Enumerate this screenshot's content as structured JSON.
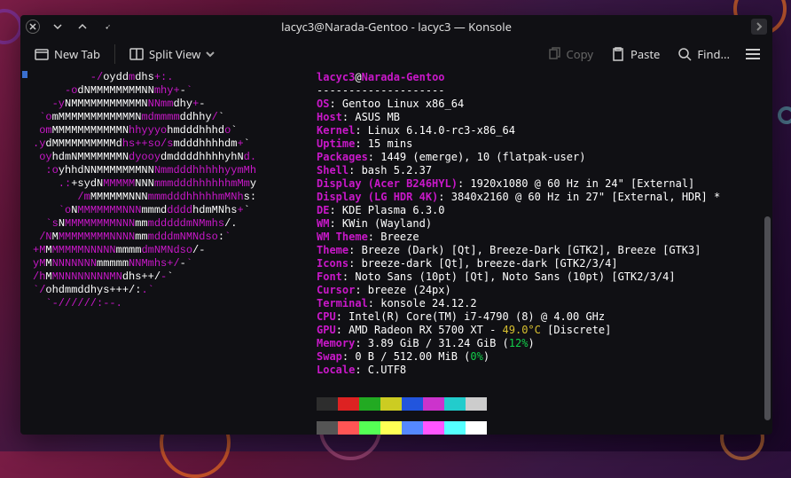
{
  "window": {
    "title": "lacyc3@Narada-Gentoo - lacyc3 — Konsole"
  },
  "toolbar": {
    "new_tab": "New Tab",
    "split_view": "Split View",
    "copy": "Copy",
    "paste": "Paste",
    "find": "Find..."
  },
  "fetch": {
    "user": "lacyc3",
    "at": "@",
    "host": "Narada-Gentoo",
    "sep": "--------------------",
    "rows": [
      {
        "k": "OS",
        "v": ": Gentoo Linux x86_64"
      },
      {
        "k": "Host",
        "v": ": ASUS MB"
      },
      {
        "k": "Kernel",
        "v": ": Linux 6.14.0-rc3-x86_64"
      },
      {
        "k": "Uptime",
        "v": ": 15 mins"
      },
      {
        "k": "Packages",
        "v": ": 1449 (emerge), 10 (flatpak-user)"
      },
      {
        "k": "Shell",
        "v": ": bash 5.2.37"
      },
      {
        "k": "Display (Acer B246HYL)",
        "v": ": 1920x1080 @ 60 Hz in 24\" [External]"
      },
      {
        "k": "Display (LG HDR 4K)",
        "v": ": 3840x2160 @ 60 Hz in 27\" [External, HDR] *"
      },
      {
        "k": "DE",
        "v": ": KDE Plasma 6.3.0"
      },
      {
        "k": "WM",
        "v": ": KWin (Wayland)"
      },
      {
        "k": "WM Theme",
        "v": ": Breeze"
      },
      {
        "k": "Theme",
        "v": ": Breeze (Dark) [Qt], Breeze-Dark [GTK2], Breeze [GTK3]"
      },
      {
        "k": "Icons",
        "v": ": breeze-dark [Qt], breeze-dark [GTK2/3/4]"
      },
      {
        "k": "Font",
        "v": ": Noto Sans (10pt) [Qt], Noto Sans (10pt) [GTK2/3/4]"
      },
      {
        "k": "Cursor",
        "v": ": breeze (24px)"
      },
      {
        "k": "Terminal",
        "v": ": konsole 24.12.2"
      },
      {
        "k": "CPU",
        "v": ": Intel(R) Core(TM) i7-4790 (8) @ 4.00 GHz"
      },
      {
        "k": "GPU",
        "v_pre": ": AMD Radeon RX 5700 XT - ",
        "temp": "49.0°C",
        "v_post": " [Discrete]"
      },
      {
        "k": "Memory",
        "v_pre": ": 3.89 GiB / 31.24 GiB (",
        "pct": "12%",
        "v_post": ")"
      },
      {
        "k": "Swap",
        "v_pre": ": 0 B / 512.00 MiB (",
        "pct": "0%",
        "v_post": ")"
      },
      {
        "k": "Locale",
        "v": ": C.UTF8"
      }
    ],
    "palette_row1": [
      "#2d2d2d",
      "#d22",
      "#2a2",
      "#cc2",
      "#25d",
      "#c3c",
      "#2cc",
      "#ccc"
    ],
    "palette_row2": [
      "#555",
      "#f55",
      "#5f5",
      "#ff5",
      "#58f",
      "#f5f",
      "#5ff",
      "#fff"
    ]
  },
  "logo_lines": [
    [
      [
        "m",
        "         -/"
      ],
      [
        "w",
        "oydd"
      ],
      [
        "m",
        "m"
      ],
      [
        "w",
        "dhs"
      ],
      [
        "m",
        "+:."
      ]
    ],
    [
      [
        "m",
        "     -o"
      ],
      [
        "w",
        "dNMMMMMMMMNN"
      ],
      [
        "m",
        "mhy+"
      ],
      [
        "w",
        "-"
      ],
      [
        "m",
        "`"
      ]
    ],
    [
      [
        "m",
        "   -y"
      ],
      [
        "w",
        "NMMMMMMMMMMMN"
      ],
      [
        "m",
        "NNmm"
      ],
      [
        "w",
        "dhy"
      ],
      [
        "m",
        "+"
      ],
      [
        "w",
        "-"
      ]
    ],
    [
      [
        "m",
        " `o"
      ],
      [
        "w",
        "mMMMMMMMMMMMMN"
      ],
      [
        "m",
        "mdmmmm"
      ],
      [
        "w",
        "ddhhy"
      ],
      [
        "m",
        "/"
      ],
      [
        "w",
        "`"
      ]
    ],
    [
      [
        "m",
        " om"
      ],
      [
        "w",
        "MMMMMMMMMMMN"
      ],
      [
        "m",
        "hhyyyo"
      ],
      [
        "w",
        "hmdddhhhd"
      ],
      [
        "m",
        "o"
      ],
      [
        "w",
        "`"
      ]
    ],
    [
      [
        "m",
        ".y"
      ],
      [
        "w",
        "dMMMMMMMMMMd"
      ],
      [
        "m",
        "hs++so/s"
      ],
      [
        "w",
        "mdddhhhhdm"
      ],
      [
        "m",
        "+"
      ],
      [
        "w",
        "`"
      ]
    ],
    [
      [
        "m",
        " oy"
      ],
      [
        "w",
        "hdmNMMMMMMMN"
      ],
      [
        "m",
        "dyooy"
      ],
      [
        "w",
        "dmddddhhhhyhN"
      ],
      [
        "m",
        "d."
      ]
    ],
    [
      [
        "m",
        "  :o"
      ],
      [
        "w",
        "yhhdNNMMMMMMMNN"
      ],
      [
        "m",
        "NmmdddhhhhhyymMh"
      ]
    ],
    [
      [
        "m",
        "    .:"
      ],
      [
        "w",
        "+sydN"
      ],
      [
        "m",
        "MMMMM"
      ],
      [
        "w",
        "NNN"
      ],
      [
        "m",
        "mmmdddhhhhhhmMm"
      ],
      [
        "w",
        "y"
      ]
    ],
    [
      [
        "m",
        "       /m"
      ],
      [
        "w",
        "MMMMMMNNN"
      ],
      [
        "m",
        "mmmdddhhhhhmMNh"
      ],
      [
        "w",
        "s:"
      ]
    ],
    [
      [
        "m",
        "    `o"
      ],
      [
        "w",
        "N"
      ],
      [
        "m",
        "MMMMMMMNNN"
      ],
      [
        "w",
        "mmmd"
      ],
      [
        "m",
        "dddd"
      ],
      [
        "w",
        "hdmMNhs"
      ],
      [
        "m",
        "+"
      ],
      [
        "w",
        "`"
      ]
    ],
    [
      [
        "m",
        "  `s"
      ],
      [
        "w",
        "N"
      ],
      [
        "m",
        "MMMMMMMMNNN"
      ],
      [
        "w",
        "mm"
      ],
      [
        "m",
        "mdddddmNMmhs"
      ],
      [
        "w",
        "/."
      ]
    ],
    [
      [
        "m",
        " /N"
      ],
      [
        "w",
        "M"
      ],
      [
        "m",
        "MMMMMMMMNNNN"
      ],
      [
        "w",
        "mm"
      ],
      [
        "m",
        "mdddmNMNdso"
      ],
      [
        "w",
        ":"
      ],
      [
        "m",
        "`"
      ]
    ],
    [
      [
        "m",
        "+M"
      ],
      [
        "w",
        "M"
      ],
      [
        "m",
        "MMMMMNNNNN"
      ],
      [
        "w",
        "mmmm"
      ],
      [
        "m",
        "dmNMNdso"
      ],
      [
        "w",
        "/-"
      ]
    ],
    [
      [
        "m",
        "yM"
      ],
      [
        "w",
        "M"
      ],
      [
        "m",
        "NNNNNNN"
      ],
      [
        "w",
        "mmmmm"
      ],
      [
        "m",
        "NNMmhs+/"
      ],
      [
        "w",
        "-"
      ],
      [
        "m",
        "`"
      ]
    ],
    [
      [
        "m",
        "/h"
      ],
      [
        "w",
        "M"
      ],
      [
        "m",
        "MNNNNNNNNMN"
      ],
      [
        "w",
        "dhs++/"
      ],
      [
        "m",
        "-"
      ],
      [
        "w",
        "`"
      ]
    ],
    [
      [
        "m",
        "`/"
      ],
      [
        "w",
        "ohdmmddhys+++/:"
      ],
      [
        "m",
        ".`"
      ]
    ],
    [
      [
        "m",
        "  `-//////:--."
      ]
    ]
  ]
}
